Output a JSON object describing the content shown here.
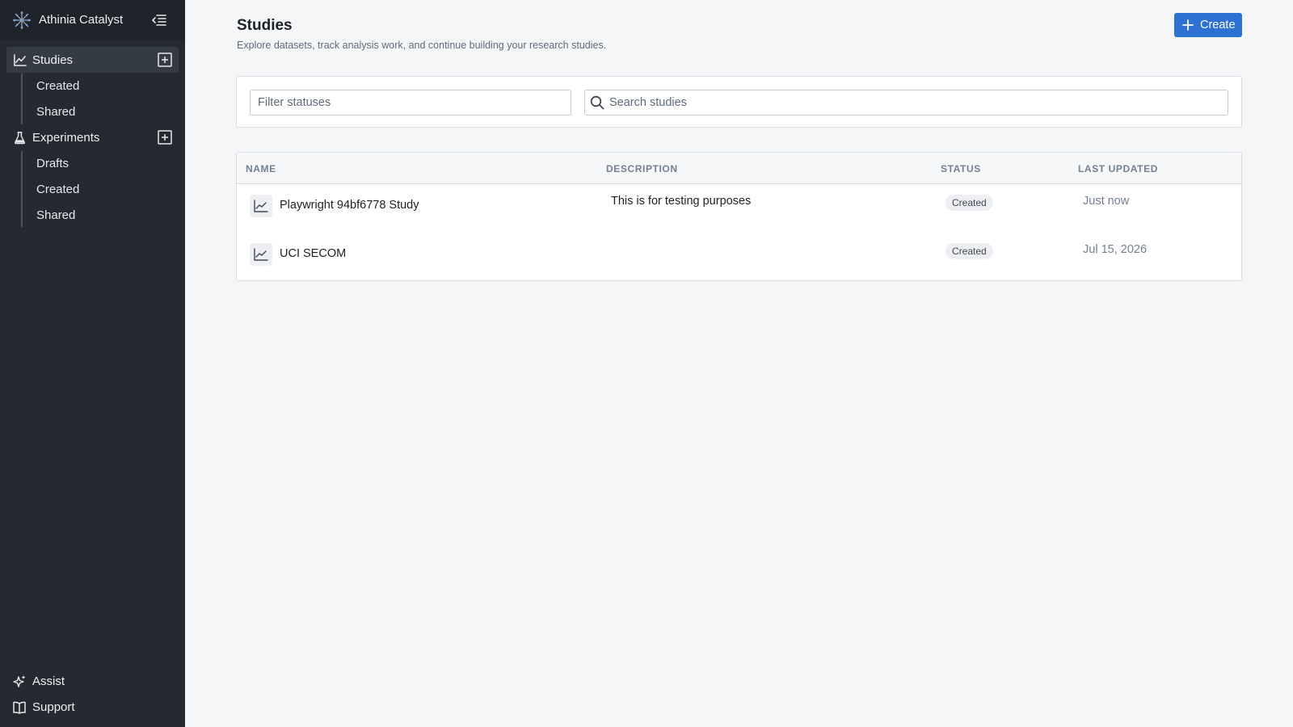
{
  "app": {
    "name": "Athinia Catalyst"
  },
  "sidebar": {
    "studies": {
      "label": "Studies",
      "items": [
        "Created",
        "Shared"
      ]
    },
    "experiments": {
      "label": "Experiments",
      "items": [
        "Drafts",
        "Created",
        "Shared"
      ]
    },
    "bottom": {
      "assist": "Assist",
      "support": "Support"
    }
  },
  "header": {
    "title": "Studies",
    "subtitle": "Explore datasets, track analysis work, and continue building your research studies.",
    "create_label": "Create"
  },
  "filters": {
    "status_placeholder": "Filter statuses",
    "search_placeholder": "Search studies"
  },
  "table": {
    "columns": [
      "NAME",
      "DESCRIPTION",
      "STATUS",
      "LAST UPDATED"
    ],
    "rows": [
      {
        "name": "Playwright 94bf6778 Study",
        "description": "This is for testing purposes",
        "status": "Created",
        "updated": "Just now"
      },
      {
        "name": "UCI SECOM",
        "description": "",
        "status": "Created",
        "updated": "Jul 15, 2026"
      }
    ]
  },
  "colors": {
    "sidebar_bg": "#252a31",
    "accent": "#2d72d2",
    "page_bg": "#f5f6f7"
  },
  "icons": {
    "brand": "catalyst-logo-icon",
    "collapse": "collapse-sidebar-icon",
    "studies": "chart-icon",
    "experiments": "flask-icon",
    "add": "add-square-icon",
    "assist": "sparkle-icon",
    "support": "book-icon",
    "search": "search-icon",
    "plus": "plus-icon"
  }
}
